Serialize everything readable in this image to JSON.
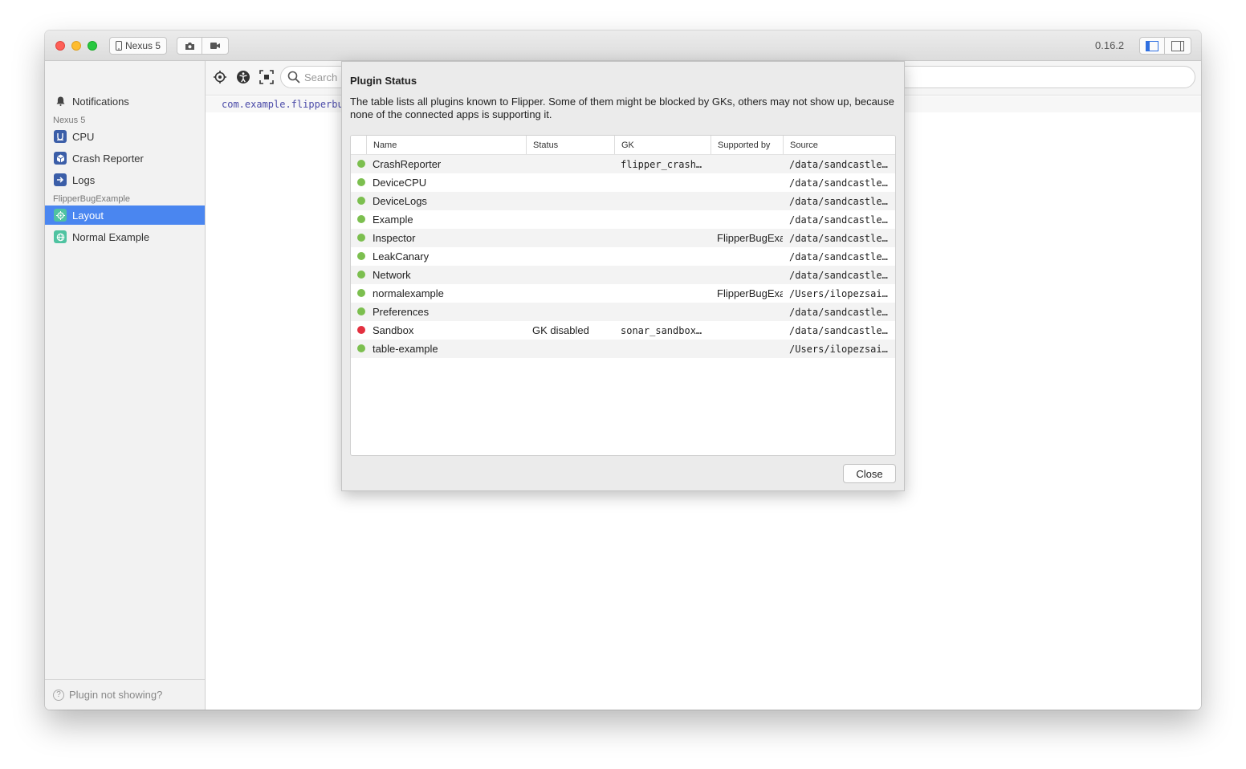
{
  "titlebar": {
    "device_label": "Nexus 5",
    "version": "0.16.2",
    "icons": [
      "phone-icon",
      "camera-icon",
      "video-icon",
      "left-sidebar-icon",
      "right-sidebar-icon"
    ]
  },
  "sidebar": {
    "notifications": "Notifications",
    "group1": "Nexus 5",
    "items1": [
      {
        "label": "CPU",
        "icon": "cpu-icon",
        "color": "#3b5ea8"
      },
      {
        "label": "Crash Reporter",
        "icon": "crash-icon",
        "color": "#3b5ea8"
      },
      {
        "label": "Logs",
        "icon": "logs-icon",
        "color": "#3b5ea8"
      }
    ],
    "group2": "FlipperBugExample",
    "items2": [
      {
        "label": "Layout",
        "icon": "layout-icon",
        "color": "#4fc3a1"
      },
      {
        "label": "Normal Example",
        "icon": "globe-icon",
        "color": "#4fc3a1"
      }
    ],
    "footer": "Plugin not showing?",
    "active_color": "#4a86f0"
  },
  "main": {
    "search_placeholder": "Search",
    "package": "com.example.flipperbu"
  },
  "modal": {
    "title": "Plugin Status",
    "description": "The table lists all plugins known to Flipper. Some of them might be blocked by GKs, others may not show up, because none of the connected apps is supporting it.",
    "columns": [
      "Name",
      "Status",
      "GK",
      "Supported by",
      "Source"
    ],
    "rows": [
      {
        "name": "CrashReporter",
        "status": "",
        "gk": "flipper_crash…",
        "supported": "",
        "source": "/data/sandcastle…",
        "ok": true
      },
      {
        "name": "DeviceCPU",
        "status": "",
        "gk": "",
        "supported": "",
        "source": "/data/sandcastle…",
        "ok": true
      },
      {
        "name": "DeviceLogs",
        "status": "",
        "gk": "",
        "supported": "",
        "source": "/data/sandcastle…",
        "ok": true
      },
      {
        "name": "Example",
        "status": "",
        "gk": "",
        "supported": "",
        "source": "/data/sandcastle…",
        "ok": true
      },
      {
        "name": "Inspector",
        "status": "",
        "gk": "",
        "supported": "FlipperBugExa",
        "source": "/data/sandcastle…",
        "ok": true
      },
      {
        "name": "LeakCanary",
        "status": "",
        "gk": "",
        "supported": "",
        "source": "/data/sandcastle…",
        "ok": true
      },
      {
        "name": "Network",
        "status": "",
        "gk": "",
        "supported": "",
        "source": "/data/sandcastle…",
        "ok": true
      },
      {
        "name": "normalexample",
        "status": "",
        "gk": "",
        "supported": "FlipperBugExa",
        "source": "/Users/ilopezsai…",
        "ok": true
      },
      {
        "name": "Preferences",
        "status": "",
        "gk": "",
        "supported": "",
        "source": "/data/sandcastle…",
        "ok": true
      },
      {
        "name": "Sandbox",
        "status": "GK disabled",
        "gk": "sonar_sandbox…",
        "supported": "",
        "source": "/data/sandcastle…",
        "ok": false
      },
      {
        "name": "table-example",
        "status": "",
        "gk": "",
        "supported": "",
        "source": "/Users/ilopezsai…",
        "ok": true
      }
    ],
    "status_colors": {
      "ok": "#7cbf4f",
      "error": "#e3303f"
    },
    "close_label": "Close"
  }
}
